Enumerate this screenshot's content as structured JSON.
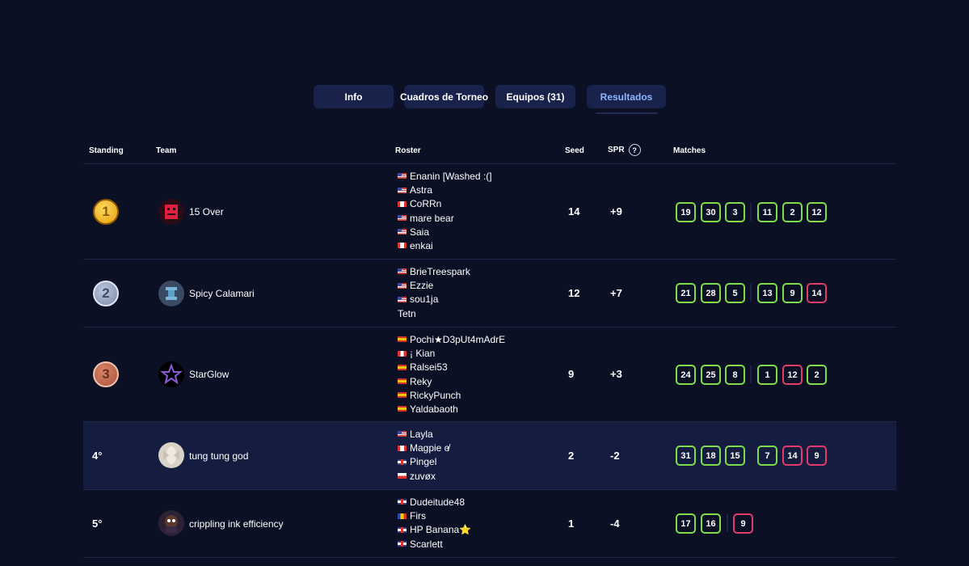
{
  "tabs": [
    "Info",
    "Cuadros de Torneo",
    "Equipos (31)",
    "Resultados"
  ],
  "headers": {
    "standing": "Standing",
    "team": "Team",
    "roster": "Roster",
    "seed": "Seed",
    "spr": "SPR",
    "help": "?",
    "matches": "Matches"
  },
  "colors": {
    "background": "#0b1025",
    "win": "#7fdc4a",
    "loss": "#e23a6a",
    "active_tab": "#8fb7ff"
  },
  "rows": [
    {
      "standing": "1",
      "team": "15 Over",
      "seed": "14",
      "spr": "+9",
      "roster": [
        [
          "us",
          "Enanin [Washed :(]"
        ],
        [
          "us",
          "Astra"
        ],
        [
          "ca",
          "CoRRn"
        ],
        [
          "us",
          "mare bear"
        ],
        [
          "us",
          "Saia"
        ],
        [
          "ca",
          "enkai"
        ]
      ],
      "matches": [
        [
          "19",
          "w"
        ],
        [
          "30",
          "w"
        ],
        [
          "3",
          "w"
        ],
        [
          "11",
          "w"
        ],
        [
          "2",
          "w"
        ],
        [
          "12",
          "w"
        ]
      ]
    },
    {
      "standing": "2",
      "team": "Spicy Calamari",
      "seed": "12",
      "spr": "+7",
      "roster": [
        [
          "us",
          "BrieTreespark"
        ],
        [
          "us",
          "Ezzie"
        ],
        [
          "us",
          "sou1ja"
        ],
        [
          "",
          "Tetn"
        ]
      ],
      "matches": [
        [
          "21",
          "w"
        ],
        [
          "28",
          "w"
        ],
        [
          "5",
          "w"
        ],
        [
          "13",
          "w"
        ],
        [
          "9",
          "w"
        ],
        [
          "14",
          "l"
        ]
      ]
    },
    {
      "standing": "3",
      "team": "StarGlow",
      "seed": "9",
      "spr": "+3",
      "roster": [
        [
          "es",
          "Pochi★D3pUt4mAdrE"
        ],
        [
          "pe",
          "¡ Kian"
        ],
        [
          "es",
          "Ralsei53"
        ],
        [
          "es",
          "Reky"
        ],
        [
          "es",
          "RickyPunch"
        ],
        [
          "es",
          "Yaldabaoth"
        ]
      ],
      "matches": [
        [
          "24",
          "w"
        ],
        [
          "25",
          "w"
        ],
        [
          "8",
          "w"
        ],
        [
          "1",
          "w"
        ],
        [
          "12",
          "l"
        ],
        [
          "2",
          "w"
        ]
      ]
    },
    {
      "standing": "4°",
      "team": "tung tung god",
      "seed": "2",
      "spr": "-2",
      "roster": [
        [
          "us",
          "Layla"
        ],
        [
          "ca",
          "Magpie ɞ̸"
        ],
        [
          "gb",
          "Pingel"
        ],
        [
          "pl",
          "zuvøx"
        ]
      ],
      "matches": [
        [
          "31",
          "w"
        ],
        [
          "18",
          "w"
        ],
        [
          "15",
          "w"
        ],
        [
          "7",
          "w"
        ],
        [
          "14",
          "l"
        ],
        [
          "9",
          "l"
        ]
      ]
    },
    {
      "standing": "5°",
      "team": "crippling ink efficiency",
      "seed": "1",
      "spr": "-4",
      "roster": [
        [
          "gb",
          "Dudeitude48"
        ],
        [
          "ro",
          "Firs"
        ],
        [
          "gb",
          "HP Banana⭐"
        ],
        [
          "gb",
          "Scarlett"
        ]
      ],
      "matches": [
        [
          "17",
          "w"
        ],
        [
          "16",
          "w"
        ],
        [
          "9",
          "l"
        ]
      ]
    }
  ]
}
